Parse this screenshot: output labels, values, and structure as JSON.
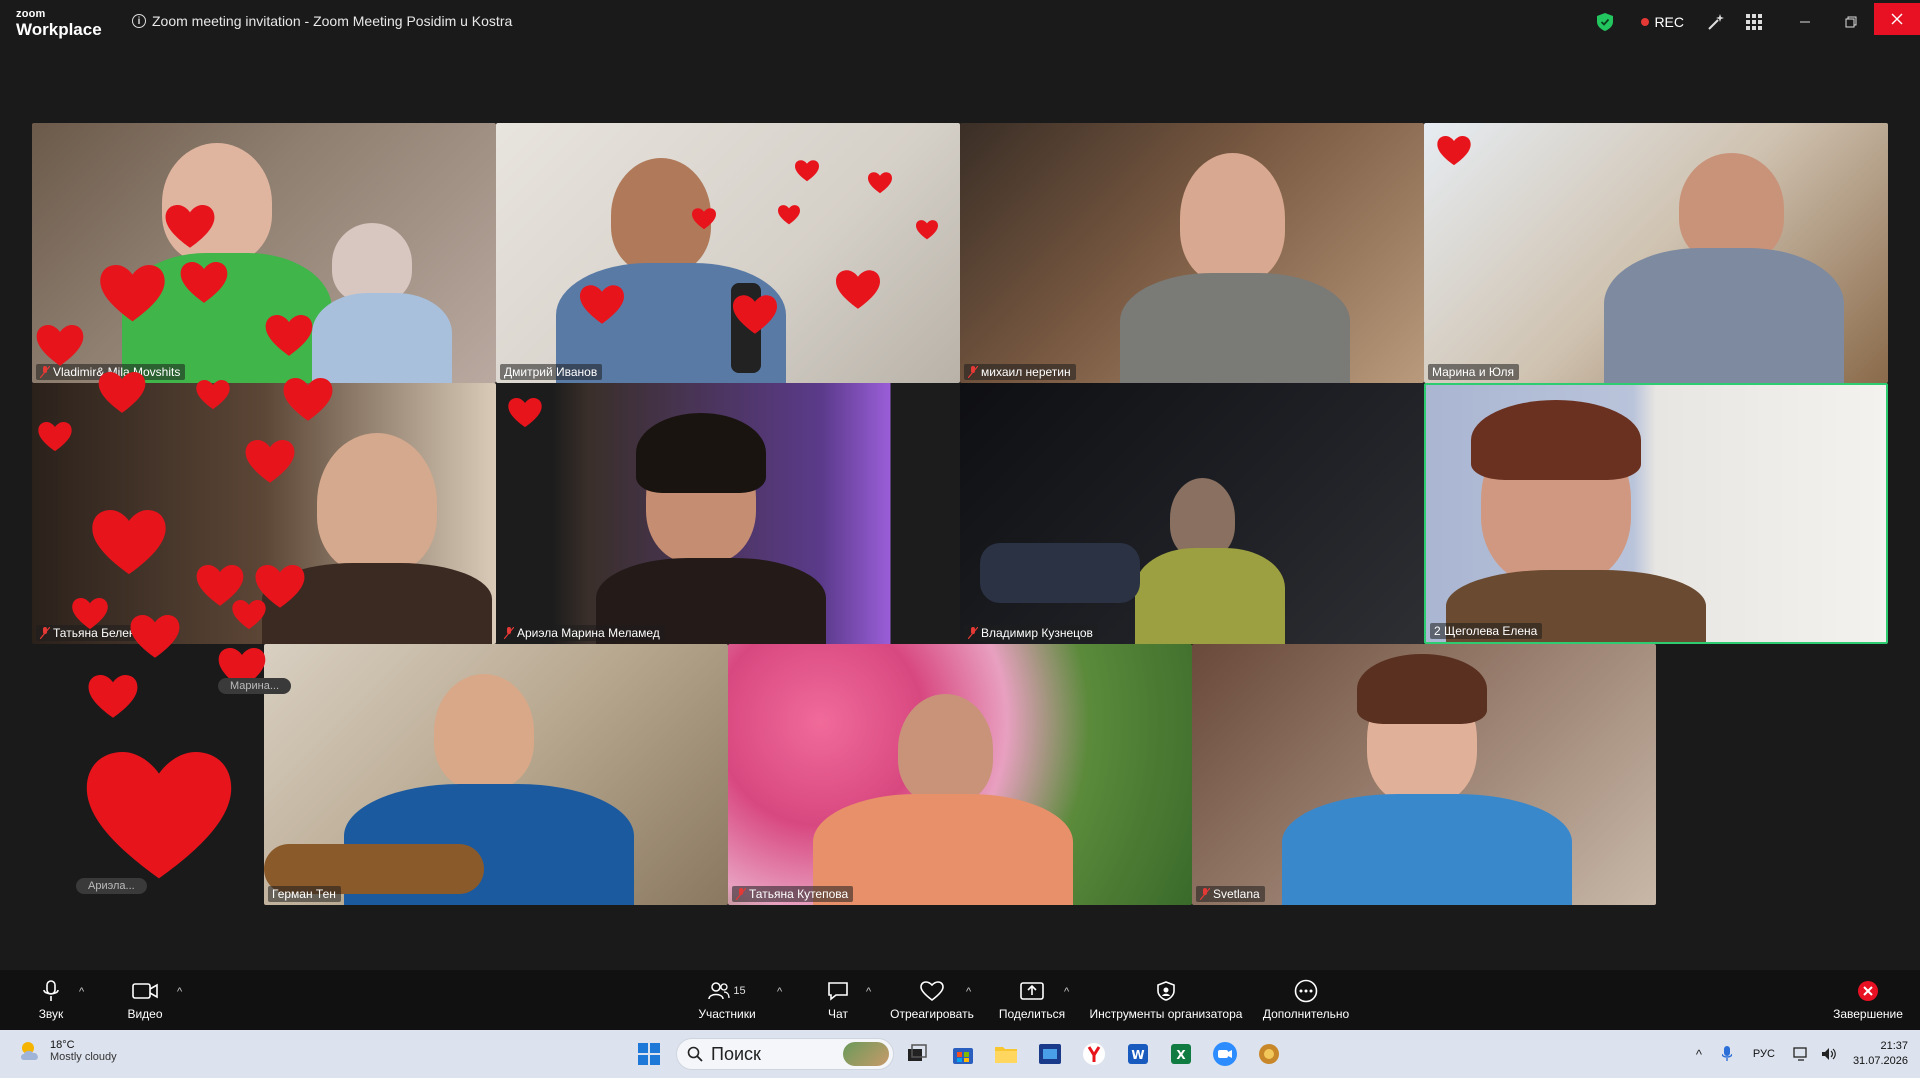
{
  "window": {
    "logo_top": "zoom",
    "logo_bottom": "Workplace",
    "title": "Zoom meeting invitation - Zoom Meeting Posidim u Kostra",
    "rec_label": "REC"
  },
  "participants": [
    {
      "name": "Vladimir& Mila Movshits",
      "muted": true
    },
    {
      "name": "Дмитрий Иванов",
      "muted": false
    },
    {
      "name": "михаил неретин",
      "muted": true
    },
    {
      "name": "Марина и Юля",
      "muted": false
    },
    {
      "name": "Татьяна Беленькая",
      "muted": true
    },
    {
      "name": "Ариэла Марина Меламед",
      "muted": true
    },
    {
      "name": "Владимир Кузнецов",
      "muted": true
    },
    {
      "name": "2 Щеголева Елена",
      "muted": false,
      "active_speaker": true
    },
    {
      "name": "Герман Тен",
      "muted": false
    },
    {
      "name": "Татьяна Кутепова",
      "muted": true
    },
    {
      "name": "Svetlana",
      "muted": true
    }
  ],
  "floating_pills": [
    "Ариэла...",
    "Марина..."
  ],
  "toolbar": {
    "audio": "Звук",
    "video": "Видео",
    "participants": "Участники",
    "participants_count": "15",
    "chat": "Чат",
    "react": "Отреагировать",
    "share": "Поделиться",
    "host_tools": "Инструменты организатора",
    "more": "Дополнительно",
    "end": "Завершение"
  },
  "taskbar": {
    "temperature": "18°C",
    "weather": "Mostly cloudy",
    "search_placeholder": "Поиск",
    "language": "РУС",
    "time": "21:37",
    "date": "31.07.2026"
  },
  "colors": {
    "active_speaker_border": "#2ecc71",
    "heart": "#e8141c",
    "close_button": "#e81123",
    "rec_dot": "#e53935",
    "shield": "#22c55e"
  }
}
